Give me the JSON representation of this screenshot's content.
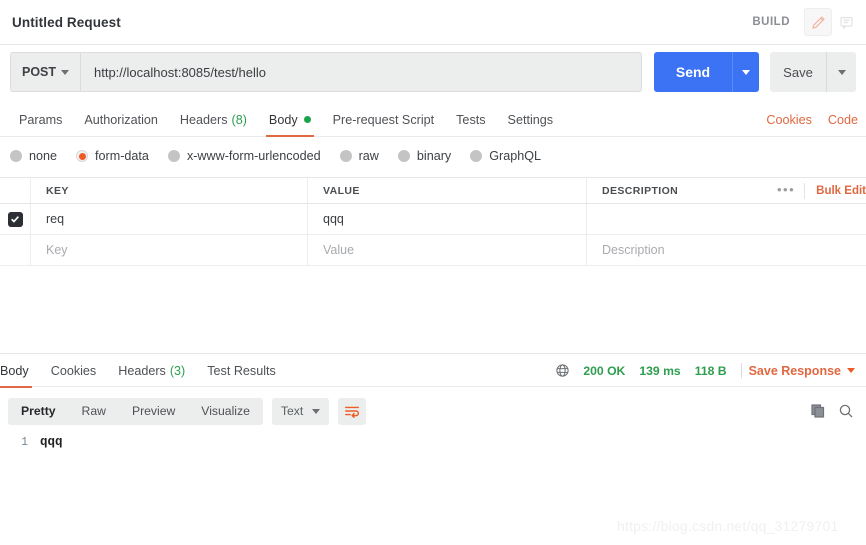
{
  "titlebar": {
    "request_title": "Untitled Request",
    "build_label": "BUILD",
    "edit_icon": "pencil-icon",
    "comment_icon": "comment-icon"
  },
  "urlbar": {
    "method": "POST",
    "url": "http://localhost:8085/test/hello",
    "send_label": "Send",
    "save_label": "Save"
  },
  "request_tabs": [
    {
      "label": "Params",
      "count": "",
      "active": false
    },
    {
      "label": "Authorization",
      "count": "",
      "active": false
    },
    {
      "label": "Headers",
      "count": "(8)",
      "active": false
    },
    {
      "label": "Body",
      "count": "",
      "active": true
    },
    {
      "label": "Pre-request Script",
      "count": "",
      "active": false
    },
    {
      "label": "Tests",
      "count": "",
      "active": false
    },
    {
      "label": "Settings",
      "count": "",
      "active": false
    }
  ],
  "request_tabs_right": [
    {
      "label": "Cookies"
    },
    {
      "label": "Code"
    }
  ],
  "body_types": [
    {
      "label": "none",
      "selected": false
    },
    {
      "label": "form-data",
      "selected": true
    },
    {
      "label": "x-www-form-urlencoded",
      "selected": false
    },
    {
      "label": "raw",
      "selected": false
    },
    {
      "label": "binary",
      "selected": false
    },
    {
      "label": "GraphQL",
      "selected": false
    }
  ],
  "kv_table": {
    "headers": {
      "key": "KEY",
      "value": "VALUE",
      "description": "DESCRIPTION"
    },
    "more_icon": "•••",
    "bulk_edit": "Bulk Edit",
    "rows": [
      {
        "checked": true,
        "key": "req",
        "value": "qqq",
        "description": ""
      }
    ],
    "placeholders": {
      "key": "Key",
      "value": "Value",
      "description": "Description"
    }
  },
  "response_tabs": [
    {
      "label": "Body",
      "count": "",
      "active": true
    },
    {
      "label": "Cookies",
      "count": "",
      "active": false
    },
    {
      "label": "Headers",
      "count": "(3)",
      "active": false
    },
    {
      "label": "Test Results",
      "count": "",
      "active": false
    }
  ],
  "response_meta": {
    "globe_icon": "globe-icon",
    "status": "200 OK",
    "time": "139 ms",
    "size": "118 B",
    "save_response": "Save Response"
  },
  "response_toolbar": {
    "views": [
      {
        "label": "Pretty",
        "active": true
      },
      {
        "label": "Raw",
        "active": false
      },
      {
        "label": "Preview",
        "active": false
      },
      {
        "label": "Visualize",
        "active": false
      }
    ],
    "format": "Text",
    "wrap_icon": "word-wrap-icon",
    "copy_icon": "copy-icon",
    "search_icon": "search-icon"
  },
  "response_body": {
    "lines": [
      {
        "number": "1",
        "text": "qqq"
      }
    ]
  },
  "watermark": "https://blog.csdn.net/qq_31279701",
  "colors": {
    "accent_orange": "#e06840",
    "send_blue": "#3b73f4",
    "status_green": "#2e9e4e",
    "radio_selected": "#ef5b25"
  }
}
